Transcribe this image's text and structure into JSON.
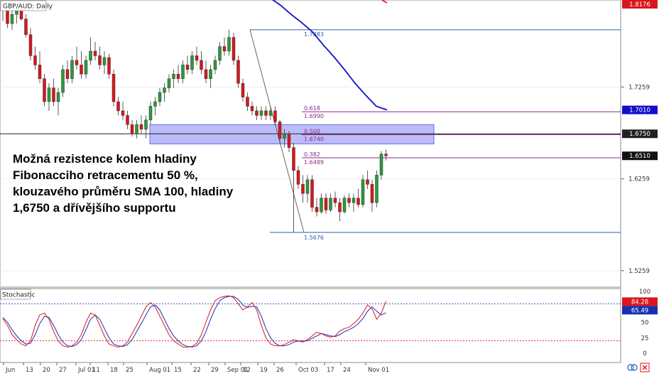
{
  "chart_data": {
    "type": "candlestick",
    "symbol_label": "GBP/AUD: Daily",
    "indicator_label": "Stochastic",
    "annotation": "Možná rezistence kolem hladiny\nFibonacciho retracementu 50 %,\nklouzavého průměru SMA 100, hladiny\n1,6750 a dřívějšího supportu",
    "price_ticks": [
      "1.7259",
      "1.6259",
      "1.5259"
    ],
    "price_markers": [
      {
        "label": "1.8176",
        "value": 1.8176,
        "color": "#d9161e"
      },
      {
        "label": "1.7010",
        "value": 1.701,
        "color": "#1010c8"
      },
      {
        "label": "1.6750",
        "value": 1.675,
        "color": "#222222"
      },
      {
        "label": "1.6510",
        "value": 1.651,
        "color": "#111111"
      }
    ],
    "price_range": [
      1.5111,
      1.8176
    ],
    "stoch_ticks": [
      "100",
      "75",
      "50",
      "25",
      "0"
    ],
    "stoch_markers": [
      {
        "label": "84.28",
        "color": "#d9161e"
      },
      {
        "label": "65.49",
        "color": "#1a2fb0"
      }
    ],
    "stoch_levels": [
      80,
      20
    ],
    "date_labels": [
      "Jun",
      "13",
      "20",
      "27",
      "Jul 01",
      "11",
      "18",
      "25",
      "Aug 01",
      "15",
      "22",
      "29",
      "Sep 01",
      "12",
      "19",
      "26",
      "Oct 03",
      "17",
      "24",
      "Nov 01"
    ],
    "fib_levels": [
      {
        "ratio": "",
        "value": 1.7883,
        "label": "1.7883"
      },
      {
        "ratio": "0.618",
        "value": 1.699,
        "label": "1.6990"
      },
      {
        "ratio": "0.500",
        "value": 1.674,
        "label": "1.6740"
      },
      {
        "ratio": "0.382",
        "value": 1.6489,
        "label": "1.6489"
      },
      {
        "ratio": "",
        "value": 1.5676,
        "label": "1.5676"
      }
    ],
    "resistance_zone": [
      1.664,
      1.685
    ],
    "horizontal_line": 1.675,
    "fib_swing": {
      "high": 1.7883,
      "low": 1.5676
    },
    "sma_100": [
      1.823,
      1.815,
      1.805,
      1.796,
      1.786,
      1.772,
      1.759,
      1.745,
      1.73,
      1.717,
      1.705,
      1.701
    ],
    "candles": [
      [
        1.815,
        1.825,
        1.798,
        1.81
      ],
      [
        1.81,
        1.818,
        1.79,
        1.795
      ],
      [
        1.795,
        1.81,
        1.788,
        1.805
      ],
      [
        1.805,
        1.82,
        1.795,
        1.815
      ],
      [
        1.815,
        1.822,
        1.798,
        1.8
      ],
      [
        1.8,
        1.805,
        1.78,
        1.783
      ],
      [
        1.783,
        1.79,
        1.755,
        1.76
      ],
      [
        1.76,
        1.77,
        1.745,
        1.75
      ],
      [
        1.75,
        1.765,
        1.73,
        1.735
      ],
      [
        1.735,
        1.74,
        1.705,
        1.71
      ],
      [
        1.71,
        1.73,
        1.7,
        1.725
      ],
      [
        1.725,
        1.735,
        1.705,
        1.71
      ],
      [
        1.71,
        1.725,
        1.695,
        1.72
      ],
      [
        1.72,
        1.75,
        1.715,
        1.745
      ],
      [
        1.745,
        1.755,
        1.73,
        1.735
      ],
      [
        1.735,
        1.76,
        1.73,
        1.755
      ],
      [
        1.755,
        1.77,
        1.745,
        1.75
      ],
      [
        1.75,
        1.765,
        1.735,
        1.74
      ],
      [
        1.74,
        1.76,
        1.735,
        1.755
      ],
      [
        1.755,
        1.78,
        1.75,
        1.765
      ],
      [
        1.765,
        1.775,
        1.755,
        1.76
      ],
      [
        1.76,
        1.77,
        1.745,
        1.75
      ],
      [
        1.75,
        1.765,
        1.74,
        1.758
      ],
      [
        1.758,
        1.762,
        1.735,
        1.74
      ],
      [
        1.74,
        1.745,
        1.705,
        1.71
      ],
      [
        1.71,
        1.715,
        1.695,
        1.7
      ],
      [
        1.7,
        1.71,
        1.69,
        1.695
      ],
      [
        1.695,
        1.7,
        1.68,
        1.685
      ],
      [
        1.685,
        1.69,
        1.672,
        1.675
      ],
      [
        1.675,
        1.69,
        1.67,
        1.685
      ],
      [
        1.685,
        1.695,
        1.675,
        1.68
      ],
      [
        1.68,
        1.695,
        1.67,
        1.69
      ],
      [
        1.69,
        1.71,
        1.685,
        1.705
      ],
      [
        1.705,
        1.715,
        1.695,
        1.71
      ],
      [
        1.71,
        1.725,
        1.705,
        1.72
      ],
      [
        1.72,
        1.73,
        1.71,
        1.725
      ],
      [
        1.725,
        1.74,
        1.72,
        1.735
      ],
      [
        1.735,
        1.745,
        1.725,
        1.74
      ],
      [
        1.74,
        1.75,
        1.73,
        1.735
      ],
      [
        1.735,
        1.755,
        1.73,
        1.75
      ],
      [
        1.75,
        1.76,
        1.74,
        1.745
      ],
      [
        1.745,
        1.765,
        1.74,
        1.76
      ],
      [
        1.76,
        1.77,
        1.75,
        1.755
      ],
      [
        1.755,
        1.765,
        1.74,
        1.745
      ],
      [
        1.745,
        1.755,
        1.73,
        1.735
      ],
      [
        1.735,
        1.75,
        1.725,
        1.745
      ],
      [
        1.745,
        1.76,
        1.74,
        1.755
      ],
      [
        1.755,
        1.775,
        1.75,
        1.77
      ],
      [
        1.77,
        1.78,
        1.76,
        1.765
      ],
      [
        1.765,
        1.7883,
        1.76,
        1.78
      ],
      [
        1.78,
        1.785,
        1.75,
        1.755
      ],
      [
        1.755,
        1.76,
        1.725,
        1.73
      ],
      [
        1.73,
        1.735,
        1.71,
        1.715
      ],
      [
        1.715,
        1.72,
        1.7,
        1.705
      ],
      [
        1.705,
        1.71,
        1.695,
        1.7
      ],
      [
        1.7,
        1.705,
        1.69,
        1.695
      ],
      [
        1.695,
        1.705,
        1.69,
        1.7
      ],
      [
        1.7,
        1.705,
        1.69,
        1.695
      ],
      [
        1.695,
        1.705,
        1.69,
        1.7
      ],
      [
        1.7,
        1.705,
        1.685,
        1.688
      ],
      [
        1.688,
        1.69,
        1.665,
        1.67
      ],
      [
        1.67,
        1.68,
        1.66,
        1.675
      ],
      [
        1.675,
        1.678,
        1.655,
        1.66
      ],
      [
        1.66,
        1.665,
        1.5676,
        1.635
      ],
      [
        1.635,
        1.64,
        1.615,
        1.62
      ],
      [
        1.62,
        1.63,
        1.6,
        1.61
      ],
      [
        1.61,
        1.63,
        1.6,
        1.625
      ],
      [
        1.625,
        1.63,
        1.59,
        1.595
      ],
      [
        1.595,
        1.605,
        1.585,
        1.59
      ],
      [
        1.59,
        1.61,
        1.588,
        1.605
      ],
      [
        1.605,
        1.61,
        1.588,
        1.592
      ],
      [
        1.592,
        1.61,
        1.59,
        1.605
      ],
      [
        1.605,
        1.612,
        1.595,
        1.6
      ],
      [
        1.6,
        1.605,
        1.58,
        1.59
      ],
      [
        1.59,
        1.608,
        1.588,
        1.605
      ],
      [
        1.605,
        1.61,
        1.595,
        1.6
      ],
      [
        1.6,
        1.61,
        1.59,
        1.605
      ],
      [
        1.605,
        1.615,
        1.595,
        1.598
      ],
      [
        1.598,
        1.63,
        1.595,
        1.625
      ],
      [
        1.625,
        1.635,
        1.615,
        1.62
      ],
      [
        1.62,
        1.625,
        1.59,
        1.6
      ],
      [
        1.6,
        1.635,
        1.595,
        1.63
      ],
      [
        1.63,
        1.656,
        1.625,
        1.653
      ],
      [
        1.653,
        1.658,
        1.646,
        1.651
      ]
    ],
    "stochastic": {
      "k": [
        56,
        45,
        30,
        22,
        15,
        12,
        20,
        45,
        62,
        65,
        55,
        35,
        20,
        12,
        10,
        12,
        18,
        30,
        50,
        65,
        62,
        45,
        28,
        15,
        12,
        10,
        12,
        18,
        32,
        45,
        60,
        75,
        82,
        75,
        60,
        45,
        30,
        20,
        15,
        10,
        10,
        11,
        16,
        30,
        50,
        70,
        85,
        90,
        92,
        93,
        90,
        80,
        70,
        75,
        82,
        70,
        45,
        25,
        15,
        12,
        12,
        14,
        18,
        22,
        20,
        18,
        22,
        28,
        34,
        32,
        28,
        26,
        28,
        36,
        40,
        42,
        48,
        55,
        65,
        78,
        72,
        55,
        65,
        84.28
      ],
      "d": [
        58,
        50,
        38,
        28,
        20,
        15,
        16,
        30,
        48,
        60,
        58,
        45,
        30,
        18,
        12,
        11,
        14,
        22,
        38,
        55,
        62,
        55,
        40,
        25,
        15,
        12,
        11,
        14,
        22,
        35,
        48,
        62,
        75,
        78,
        70,
        55,
        40,
        28,
        20,
        14,
        11,
        10,
        12,
        20,
        35,
        55,
        72,
        85,
        90,
        92,
        92,
        87,
        78,
        74,
        76,
        75,
        60,
        40,
        25,
        16,
        12,
        12,
        14,
        18,
        20,
        20,
        20,
        24,
        28,
        32,
        30,
        28,
        27,
        30,
        35,
        38,
        42,
        48,
        56,
        68,
        75,
        68,
        62,
        65.49
      ]
    }
  }
}
